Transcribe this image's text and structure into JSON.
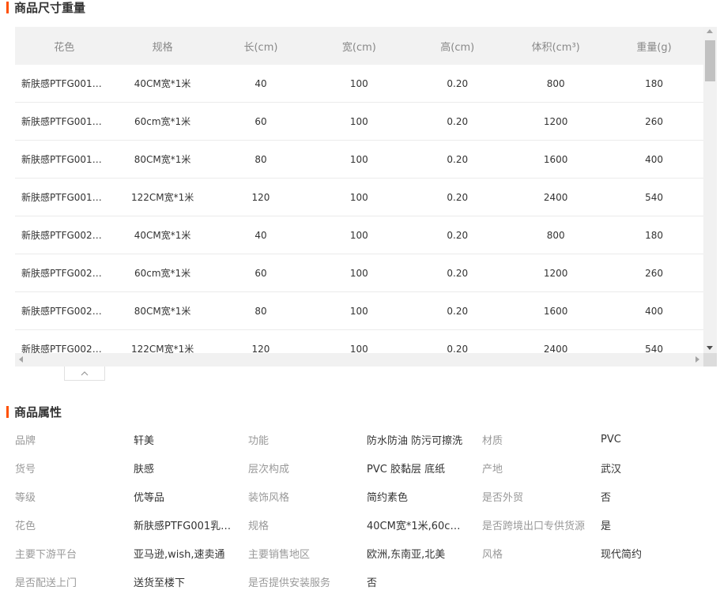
{
  "size_section": {
    "title": "商品尺寸重量"
  },
  "size_table": {
    "headers": [
      "花色",
      "规格",
      "长(cm)",
      "宽(cm)",
      "高(cm)",
      "体积(cm³)",
      "重量(g)"
    ],
    "rows": [
      [
        "新肤感PTFG001乳…",
        "40CM宽*1米",
        "40",
        "100",
        "0.20",
        "800",
        "180"
      ],
      [
        "新肤感PTFG001乳…",
        "60cm宽*1米",
        "60",
        "100",
        "0.20",
        "1200",
        "260"
      ],
      [
        "新肤感PTFG001乳…",
        "80CM宽*1米",
        "80",
        "100",
        "0.20",
        "1600",
        "400"
      ],
      [
        "新肤感PTFG001乳…",
        "122CM宽*1米",
        "120",
        "100",
        "0.20",
        "2400",
        "540"
      ],
      [
        "新肤感PTFG002哑…",
        "40CM宽*1米",
        "40",
        "100",
        "0.20",
        "800",
        "180"
      ],
      [
        "新肤感PTFG002哑…",
        "60cm宽*1米",
        "60",
        "100",
        "0.20",
        "1200",
        "260"
      ],
      [
        "新肤感PTFG002哑…",
        "80CM宽*1米",
        "80",
        "100",
        "0.20",
        "1600",
        "400"
      ],
      [
        "新肤感PTFG002哑…",
        "122CM宽*1米",
        "120",
        "100",
        "0.20",
        "2400",
        "540"
      ]
    ]
  },
  "attr_section": {
    "title": "商品属性"
  },
  "attributes": [
    [
      {
        "label": "品牌",
        "value": "轩美"
      },
      {
        "label": "功能",
        "value": "防水防油 防污可擦洗"
      },
      {
        "label": "材质",
        "value": "PVC"
      }
    ],
    [
      {
        "label": "货号",
        "value": "肤感"
      },
      {
        "label": "层次构成",
        "value": "PVC 胶黏层 底纸"
      },
      {
        "label": "产地",
        "value": "武汉"
      }
    ],
    [
      {
        "label": "等级",
        "value": "优等品"
      },
      {
        "label": "装饰风格",
        "value": "简约素色"
      },
      {
        "label": "是否外贸",
        "value": "否"
      }
    ],
    [
      {
        "label": "花色",
        "value": "新肤感PTFG001乳白…"
      },
      {
        "label": "规格",
        "value": "40CM宽*1米,60cm宽…"
      },
      {
        "label": "是否跨境出口专供货源",
        "value": "是"
      }
    ],
    [
      {
        "label": "主要下游平台",
        "value": "亚马逊,wish,速卖通"
      },
      {
        "label": "主要销售地区",
        "value": "欧洲,东南亚,北美"
      },
      {
        "label": "风格",
        "value": "现代简约"
      }
    ],
    [
      {
        "label": "是否配送上门",
        "value": "送货至楼下"
      },
      {
        "label": "是否提供安装服务",
        "value": "否"
      }
    ]
  ],
  "colors": {
    "accent": "#ff5000",
    "header_bg": "#f2f2f2"
  },
  "icons": {
    "collapse": "chevron-up-icon"
  }
}
